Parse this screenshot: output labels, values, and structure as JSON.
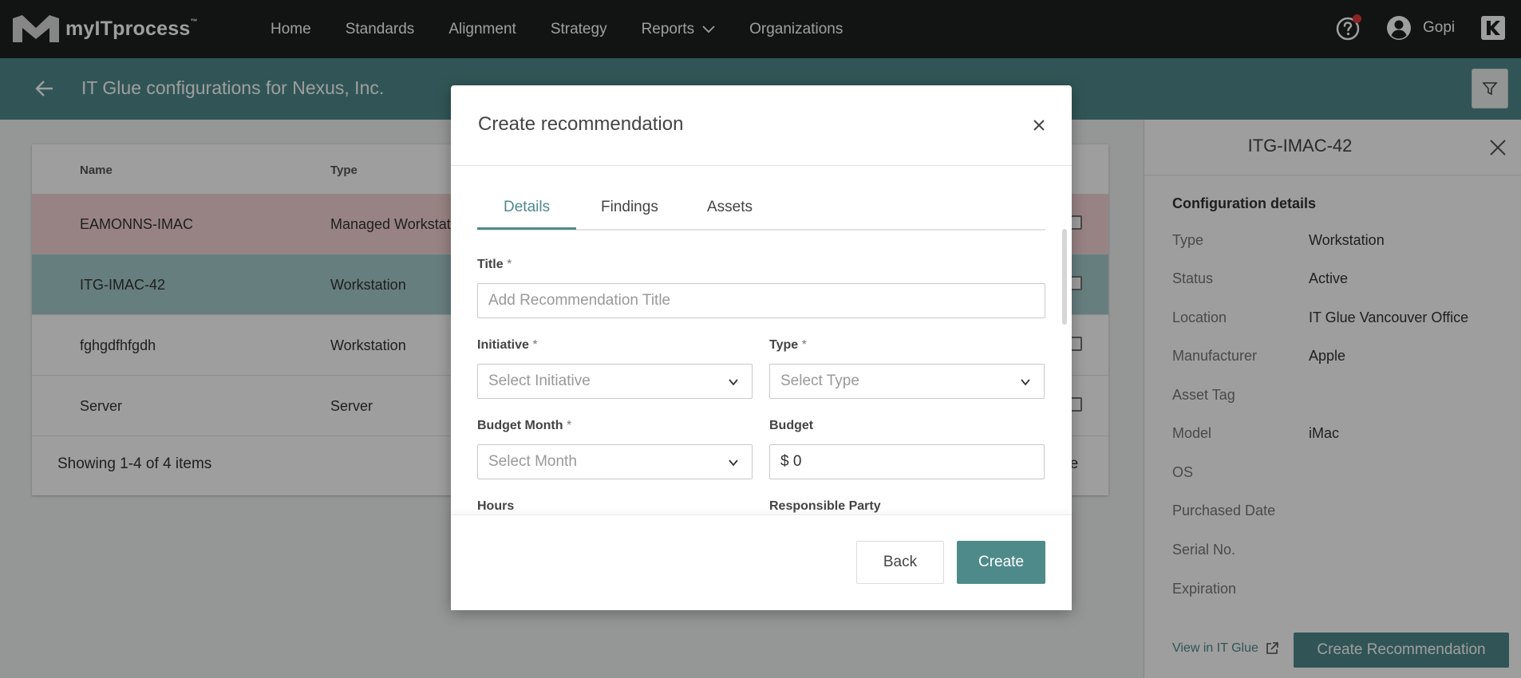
{
  "nav": {
    "brand": "myITprocess",
    "brand_tm": "™",
    "items": [
      {
        "label": "Home"
      },
      {
        "label": "Standards"
      },
      {
        "label": "Alignment"
      },
      {
        "label": "Strategy"
      },
      {
        "label": "Reports"
      },
      {
        "label": "Organizations"
      }
    ],
    "user_name": "Gopi"
  },
  "subheader": {
    "title": "IT Glue configurations for Nexus, Inc."
  },
  "table": {
    "columns": [
      "Name",
      "Type"
    ],
    "rows": [
      {
        "name": "EAMONNS-IMAC",
        "type": "Managed Workstation"
      },
      {
        "name": "ITG-IMAC-42",
        "type": "Workstation"
      },
      {
        "name": "fghgdfhfgdh",
        "type": "Workstation"
      },
      {
        "name": "Server",
        "type": "Server"
      }
    ],
    "footer": "Showing 1-4 of 4 items",
    "footer_right": "ge"
  },
  "side_panel": {
    "title": "ITG-IMAC-42",
    "section": "Configuration details",
    "fields": [
      {
        "label": "Type",
        "value": "Workstation"
      },
      {
        "label": "Status",
        "value": "Active"
      },
      {
        "label": "Location",
        "value": "IT Glue Vancouver Office"
      },
      {
        "label": "Manufacturer",
        "value": "Apple"
      },
      {
        "label": "Asset Tag",
        "value": ""
      },
      {
        "label": "Model",
        "value": "iMac"
      },
      {
        "label": "OS",
        "value": ""
      },
      {
        "label": "Purchased Date",
        "value": ""
      },
      {
        "label": "Serial No.",
        "value": ""
      },
      {
        "label": "Expiration",
        "value": ""
      }
    ],
    "link": "View in IT Glue",
    "button": "Create Recommendation"
  },
  "modal": {
    "title": "Create recommendation",
    "tabs": [
      {
        "label": "Details"
      },
      {
        "label": "Findings"
      },
      {
        "label": "Assets"
      }
    ],
    "title_label": "Title",
    "title_placeholder": "Add Recommendation Title",
    "initiative_label": "Initiative",
    "initiative_placeholder": "Select Initiative",
    "type_label": "Type",
    "type_placeholder": "Select Type",
    "budget_month_label": "Budget Month",
    "budget_month_placeholder": "Select Month",
    "budget_label": "Budget",
    "budget_value": "$ 0",
    "hours_label": "Hours",
    "responsible_label": "Responsible Party",
    "required_mark": "*",
    "back": "Back",
    "create": "Create"
  },
  "colors": {
    "nav_bg": "#1d1f20",
    "accent": "#4f8a8b",
    "row_error": "#f6d4d6",
    "row_selected": "#a7cccd",
    "notification_dot": "#e23a3a"
  }
}
